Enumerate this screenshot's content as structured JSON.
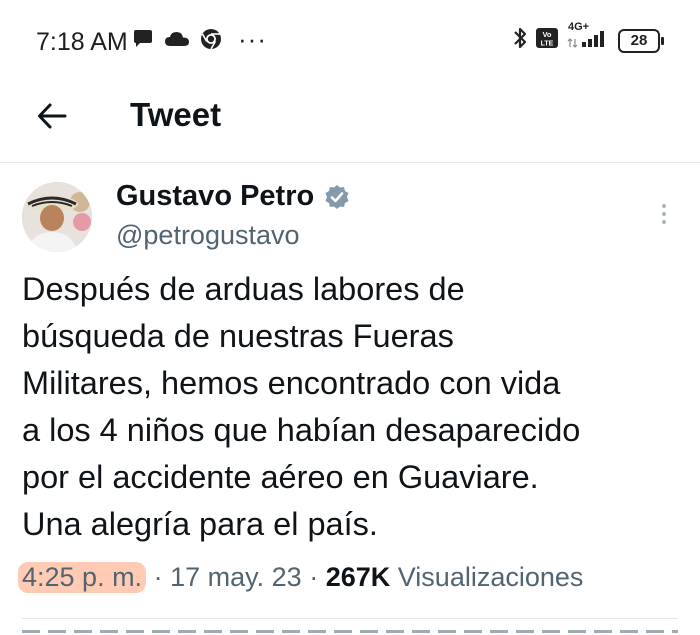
{
  "status_bar": {
    "time": "7:18 AM",
    "network_label": "4G+",
    "volte_label": "Vo LTE",
    "battery": "28",
    "icons": [
      "chat-bubble-icon",
      "cloud-icon",
      "chrome-icon",
      "more-dots-icon",
      "bluetooth-icon",
      "volte-icon",
      "signal-icon",
      "battery-icon"
    ]
  },
  "header": {
    "title": "Tweet",
    "back_icon": "arrow-left-icon"
  },
  "tweet": {
    "author_name": "Gustavo Petro",
    "handle": "@petrogustavo",
    "verified": true,
    "text": "Después de arduas labores de\nbúsqueda de nuestras Fueras\nMilitares, hemos encontrado con vida\na los 4 niños que habían desaparecido\npor el accidente aéreo en Guaviare.\nUna alegría para el país.",
    "time": "4:25 p. m.",
    "separator": "·",
    "date": "17 may. 23",
    "views_count": "267K",
    "views_label": "Visualizaciones"
  },
  "colors": {
    "text_primary": "#0f1419",
    "text_secondary": "#536471",
    "verified_badge": "#829aab",
    "highlight": "#ffa078"
  }
}
